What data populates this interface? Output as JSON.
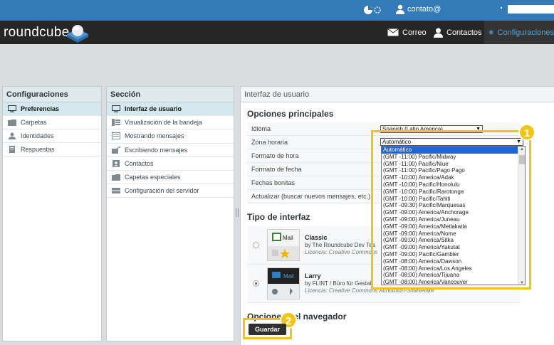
{
  "topbar": {
    "user": "contato@"
  },
  "header": {
    "logo": "roundcube",
    "nav": [
      {
        "label": "Correo",
        "icon": "envelope-icon"
      },
      {
        "label": "Contactos",
        "icon": "user-icon"
      },
      {
        "label": "Configuraciones",
        "icon": "gear-icon"
      }
    ]
  },
  "settings_panel": {
    "title": "Configuraciones",
    "items": [
      "Preferencias",
      "Carpetas",
      "Identidades",
      "Respuestas"
    ]
  },
  "section_panel": {
    "title": "Sección",
    "items": [
      "Interfaz de usuario",
      "Visualización de la bandeja",
      "Mostrando mensajes",
      "Escribiendo mensajes",
      "Contactos",
      "Capetas especiales",
      "Configuración del servidor"
    ]
  },
  "main": {
    "title": "Interfaz de usuario",
    "principal_heading": "Opciones principales",
    "rows": [
      "Idioma",
      "Zona horaria",
      "Formato de hora",
      "Formato de fecha",
      "Fechas bonitas",
      "Actualizar (buscar nuevos mensajes, etc.)"
    ],
    "language_value": "Spanish (Latin America)",
    "timezone_value": "Automático",
    "timezone_options": [
      "Automático",
      "(GMT -11:00) Pacific/Midway",
      "(GMT -11:00) Pacific/Niue",
      "(GMT -11:00) Pacific/Pago Pago",
      "(GMT -10:00) America/Adak",
      "(GMT -10:00) Pacific/Honolulu",
      "(GMT -10:00) Pacific/Rarotonga",
      "(GMT -10:00) Pacific/Tahiti",
      "(GMT -09:30) Pacific/Marquesas",
      "(GMT -09:00) America/Anchorage",
      "(GMT -09:00) America/Juneau",
      "(GMT -09:00) America/Metlakatla",
      "(GMT -09:00) America/Nome",
      "(GMT -09:00) America/Sitka",
      "(GMT -09:00) America/Yakutat",
      "(GMT -09:00) Pacific/Gambier",
      "(GMT -08:00) America/Dawson",
      "(GMT -08:00) America/Los Angeles",
      "(GMT -08:00) America/Tijuana",
      "(GMT -08:00) America/Vancouver"
    ],
    "interface_heading": "Tipo de interfaz",
    "themes": [
      {
        "name": "Classic",
        "by": "by The Roundcube Dev Tea",
        "license": "Licencia: Creative Commons",
        "thumb_label": "Mail"
      },
      {
        "name": "Larry",
        "by": "by FLINT / Büro für Gestalt",
        "license": "Licencia: Creative Commons Attribution-ShareAlike",
        "thumb_label": "Mail"
      }
    ],
    "browser_heading": "Opciones del navegador",
    "save_label": "Guardar"
  },
  "callouts": [
    "1",
    "2"
  ],
  "colors": {
    "topbar": "#3479b8",
    "header": "#262626",
    "accent": "#41a7e8",
    "highlight": "#f0c419",
    "selection": "#1e66d6"
  }
}
